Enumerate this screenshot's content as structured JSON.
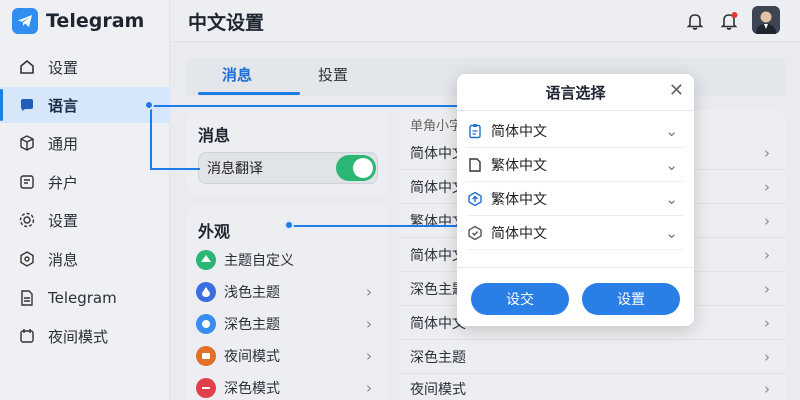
{
  "app": {
    "name": "Telegram"
  },
  "sidebar": {
    "items": [
      {
        "label": "设置",
        "icon": "home-icon"
      },
      {
        "label": "语言",
        "icon": "chat-bubble-icon",
        "active": true
      },
      {
        "label": "通用",
        "icon": "cube-icon"
      },
      {
        "label": "弁户",
        "icon": "document-icon"
      },
      {
        "label": "设置",
        "icon": "gear-icon"
      },
      {
        "label": "消息",
        "icon": "hexagon-icon"
      },
      {
        "label": "Telegram",
        "icon": "file-icon"
      },
      {
        "label": "夜间模式",
        "icon": "calendar-icon"
      }
    ]
  },
  "header": {
    "title": "中文设置"
  },
  "tabs": [
    {
      "label": "消息",
      "active": true
    },
    {
      "label": "投置"
    }
  ],
  "message_card": {
    "title": "消息",
    "translate_label": "消息翻译",
    "toggle_on": true
  },
  "appearance_card": {
    "title": "外观",
    "items": [
      {
        "label": "主题自定义",
        "color": "#2bb673"
      },
      {
        "label": "浅色主题",
        "color": "#3b6fe0"
      },
      {
        "label": "深色主题",
        "color": "#3a8ef0"
      },
      {
        "label": "夜间模式",
        "color": "#e0702a"
      },
      {
        "label": "深色模式",
        "color": "#e0404a"
      }
    ]
  },
  "right_list": {
    "header": "单角小字",
    "rows": [
      "简体中文",
      "简体中文",
      "繁体中文",
      "简体中文",
      "深色主题",
      "简体中文",
      "深色主题",
      "夜间模式"
    ]
  },
  "modal": {
    "title": "语言选择",
    "options": [
      {
        "label": "简体中文",
        "icon": "clipboard-icon"
      },
      {
        "label": "繁体中文",
        "icon": "page-icon"
      },
      {
        "label": "繁体中文",
        "icon": "upload-hex-icon"
      },
      {
        "label": "简体中文",
        "icon": "check-hex-icon"
      }
    ],
    "buttons": {
      "left": "设交",
      "right": "设置"
    }
  },
  "colors": {
    "accent": "#1f7be8",
    "toggle": "#2bb673"
  }
}
